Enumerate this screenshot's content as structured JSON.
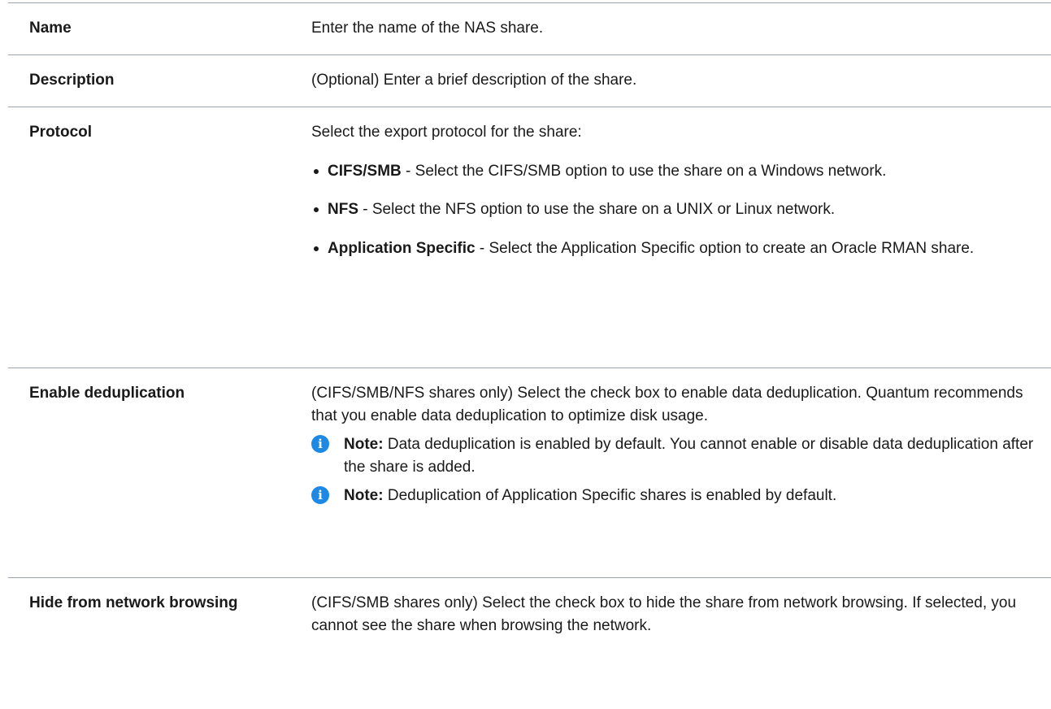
{
  "rows": [
    {
      "label": "Name",
      "text": "Enter the name of the NAS share."
    },
    {
      "label": "Description",
      "text": "(Optional) Enter a brief description of the share."
    },
    {
      "label": "Protocol",
      "intro": "Select the export protocol for the share:",
      "options": [
        {
          "name": "CIFS/SMB",
          "text": " - Select the CIFS/SMB option to use the share on a Windows network."
        },
        {
          "name": "NFS",
          "text": " - Select the NFS option to use the share on a UNIX or Linux network."
        },
        {
          "name": "Application Specific",
          "text": " - Select the Application Specific option to create an Oracle RMAN share."
        }
      ]
    },
    {
      "label": "Enable deduplication",
      "text": "(CIFS/SMB/NFS shares only) Select the check box to enable data deduplication. Quantum recommends that you enable data deduplication to optimize disk usage.",
      "notes": [
        {
          "prefix": "Note:",
          "text": " Data deduplication is enabled by default. You cannot enable or disable data deduplication after the share is added."
        },
        {
          "prefix": "Note:",
          "text": " Deduplication of Application Specific shares is enabled by default."
        }
      ]
    },
    {
      "label": "Hide from network browsing",
      "text": "(CIFS/SMB shares only) Select the check box to hide the share from network browsing. If selected, you cannot see the share when browsing the network."
    }
  ],
  "icons": {
    "note_icon": "info-icon",
    "note_icon_color": "#1e88e5",
    "note_icon_glyph": "i"
  }
}
